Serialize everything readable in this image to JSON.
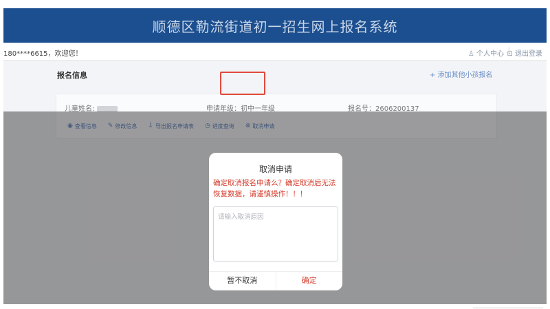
{
  "header": {
    "title": "顺德区勒流街道初一招生网上报名系统"
  },
  "topbar": {
    "welcome": "180****6615，欢迎您！",
    "user_center": "♙ 个人中心",
    "logout": "⊡ 退出登录"
  },
  "section": {
    "title": "报名信息",
    "add_other": "+ 添加其他小孩报名"
  },
  "card": {
    "child_name_label": "儿童姓名:",
    "grade": "申请年级：初中一年级",
    "reg_number": "报名号：2606200137"
  },
  "actions": [
    {
      "icon": "◉",
      "label": "查看信息"
    },
    {
      "icon": "✎",
      "label": "修改信息"
    },
    {
      "icon": "⇩",
      "label": "导出报名申请表"
    },
    {
      "icon": "◷",
      "label": "进度查询"
    },
    {
      "icon": "⊗",
      "label": "取消申请"
    }
  ],
  "dialog": {
    "title": "取消申请",
    "warning": "确定取消报名申请么？确定取消后无法恢复数据，请谨慎操作！！！",
    "placeholder": "请输入取消原因",
    "cancel_label": "暂不取消",
    "confirm_label": "确定"
  },
  "colors": {
    "header_bg": "#1c4f8f",
    "accent_link": "#6a8cc4",
    "warning_red": "#d43c2b",
    "highlight_border": "#e04a3c"
  }
}
